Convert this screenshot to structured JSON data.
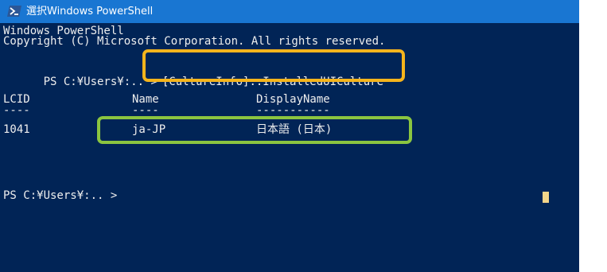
{
  "window": {
    "title": "選択Windows PowerShell",
    "icon": "powershell-icon",
    "background_color": "#012456",
    "titlebar_color": "#1976d2"
  },
  "console": {
    "banner_line1": "Windows PowerShell",
    "banner_line2": "Copyright (C) Microsoft Corporation. All rights reserved.",
    "prompt1": "PS C:¥Users¥:.. >",
    "command": "[CultureInfo]::InstalledUICulture",
    "table": {
      "headers": [
        "LCID",
        "Name",
        "DisplayName"
      ],
      "underlines": [
        "----",
        "----",
        "-----------"
      ],
      "rows": [
        [
          "1041",
          "ja-JP",
          "日本語 (日本)"
        ]
      ]
    },
    "prompt2": "PS C:¥Users¥:.. >"
  },
  "highlights": {
    "command_box_color": "#f5b41c",
    "result_box_color": "#8bc540"
  }
}
